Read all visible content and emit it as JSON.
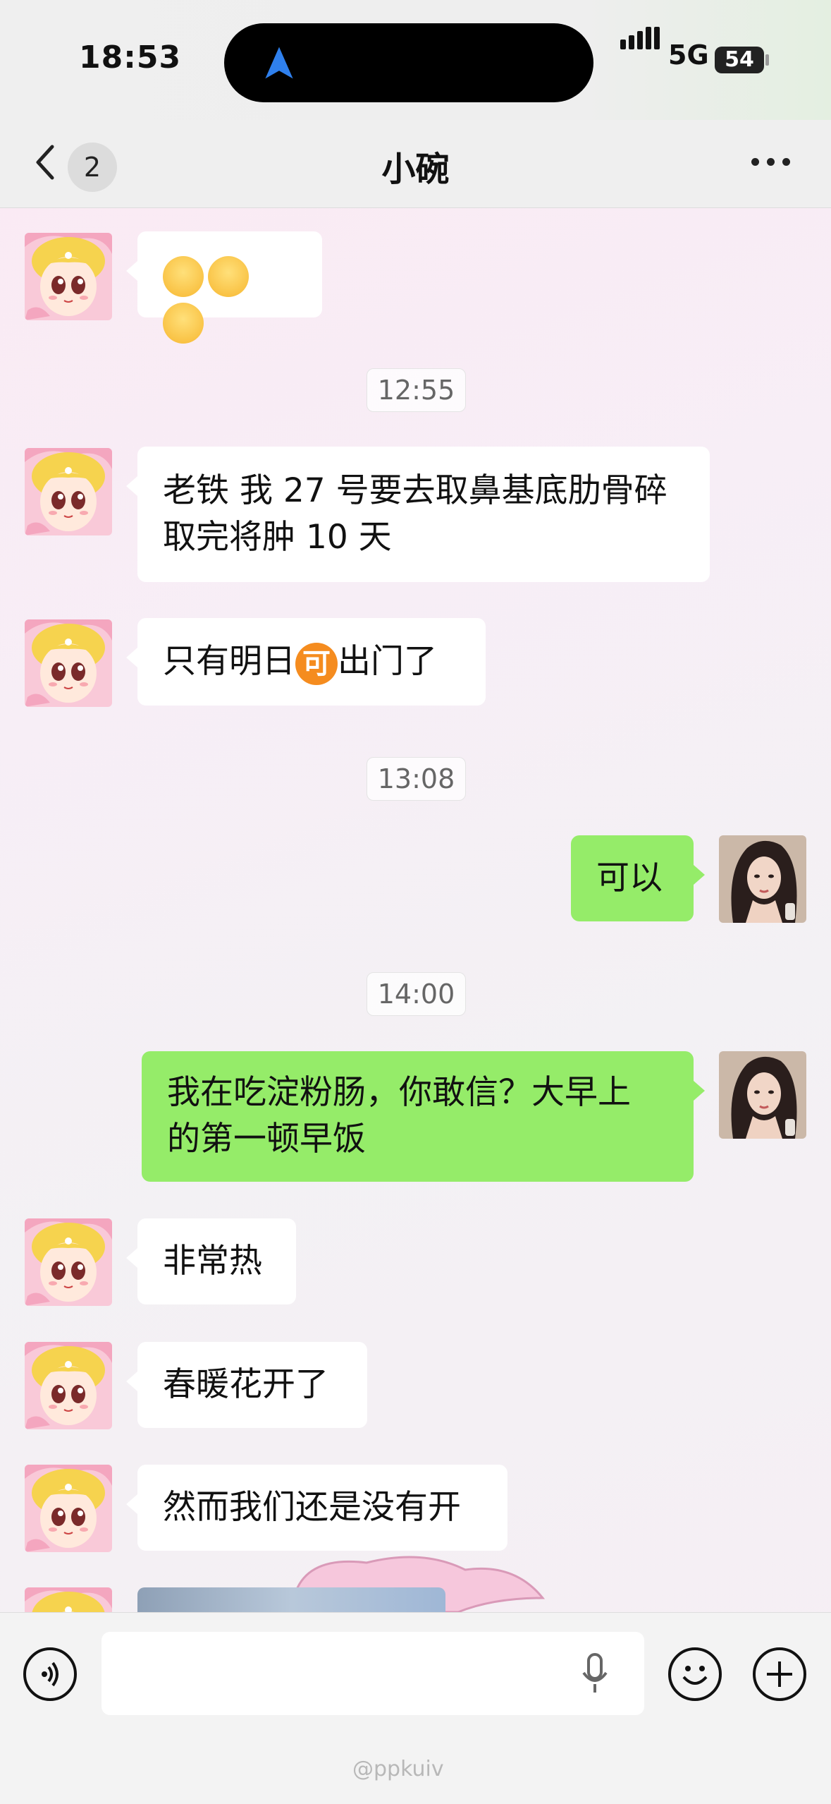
{
  "status_bar": {
    "time": "18:53",
    "network": "5G",
    "battery": "54"
  },
  "header": {
    "back_count": "2",
    "title": "小碗"
  },
  "messages": {
    "m1_emojis": "😊😊😊",
    "ts1": "12:55",
    "m2_line1": "老铁 我 27 号要去取鼻基底肋骨碎",
    "m2_line2": "取完将肿 10 天",
    "m3_before": "只有明日",
    "m3_badge": "可",
    "m3_after": "出门了",
    "ts2": "13:08",
    "m4": "可以",
    "ts3": "14:00",
    "m5_line1": "我在吃淀粉肠，你敢信？大早上",
    "m5_line2": "的第一顿早饭",
    "m6": "非常热",
    "m7": "春暖花开了",
    "m8": "然而我们还是没有开"
  },
  "watermark": "@ppkuiv",
  "colors": {
    "outgoing_bubble": "#95ec69",
    "incoming_bubble": "#ffffff",
    "nav_arrow": "#2f80ed"
  },
  "icons": [
    "navigation-arrow-icon",
    "back-chevron-icon",
    "more-dots-icon",
    "voice-toggle-icon",
    "microphone-icon",
    "emoji-icon",
    "plus-icon"
  ]
}
